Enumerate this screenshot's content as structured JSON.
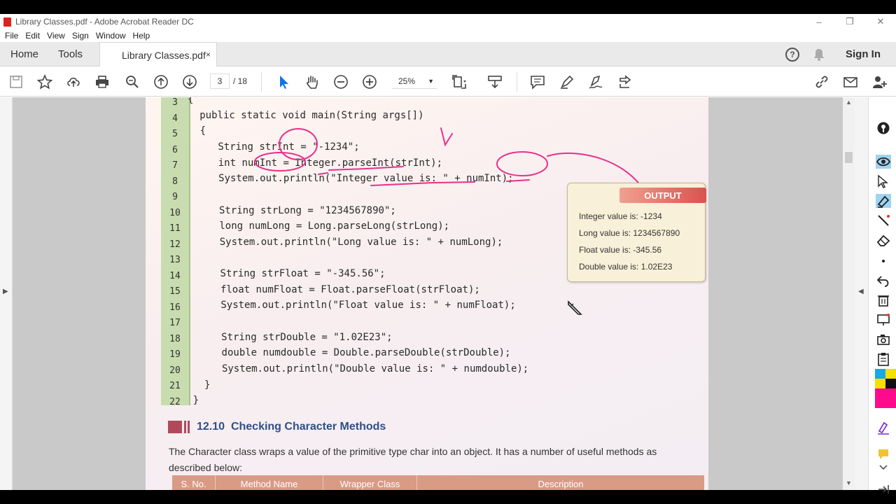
{
  "window": {
    "title": "Library Classes.pdf - Adobe Acrobat Reader DC",
    "controls": {
      "minimize": "–",
      "restore": "❐",
      "close": "✕"
    }
  },
  "menu": [
    "File",
    "Edit",
    "View",
    "Sign",
    "Window",
    "Help"
  ],
  "tabs": {
    "home": "Home",
    "tools": "Tools",
    "document": "Library Classes.pdf",
    "close": "×"
  },
  "header_right": {
    "help": "?",
    "sign_in": "Sign In"
  },
  "toolbar": {
    "page_current": "3",
    "page_total": "/ 18",
    "zoom": "25%",
    "zoom_caret": "▼"
  },
  "document": {
    "line_numbers": [
      "3",
      "4",
      "5",
      "6",
      "7",
      "8",
      "9",
      "10",
      "11",
      "12",
      "13",
      "14",
      "15",
      "16",
      "17",
      "18",
      "19",
      "20",
      "21",
      "22"
    ],
    "code_lines": [
      "{",
      "  public static void main(String args[])",
      "  {",
      "     String strInt = \"-1234\";",
      "     int numInt = Integer.parseInt(strInt);",
      "     System.out.println(\"Integer value is: \" + numInt);",
      "",
      "     String strLong = \"1234567890\";",
      "     long numLong = Long.parseLong(strLong);",
      "     System.out.println(\"Long value is: \" + numLong);",
      "",
      "     String strFloat = \"-345.56\";",
      "     float numFloat = Float.parseFloat(strFloat);",
      "     System.out.println(\"Float value is: \" + numFloat);",
      "",
      "     String strDouble = \"1.02E23\";",
      "     double numdouble = Double.parseDouble(strDouble);",
      "     System.out.println(\"Double value is: \" + numdouble);",
      "  }",
      "}"
    ],
    "output": {
      "label": "OUTPUT",
      "lines": [
        "Integer value is: -1234",
        "Long value is: 1234567890",
        "Float value is: -345.56",
        "Double value is: 1.02E23"
      ]
    },
    "section": {
      "number": "12.10",
      "title": "Checking Character Methods",
      "para1": "The Character class wraps a value of the primitive type char into an object. It has a number of useful methods as",
      "para2": "described below:"
    },
    "table_headers": [
      "S. No.",
      "Method Name",
      "Wrapper Class",
      "Description"
    ]
  },
  "colors": {
    "annotation_pink": "#e8308a",
    "gutter_green": "#c8dcaf",
    "section_blue": "#2f4f88",
    "accent_red": "#d9534f"
  }
}
